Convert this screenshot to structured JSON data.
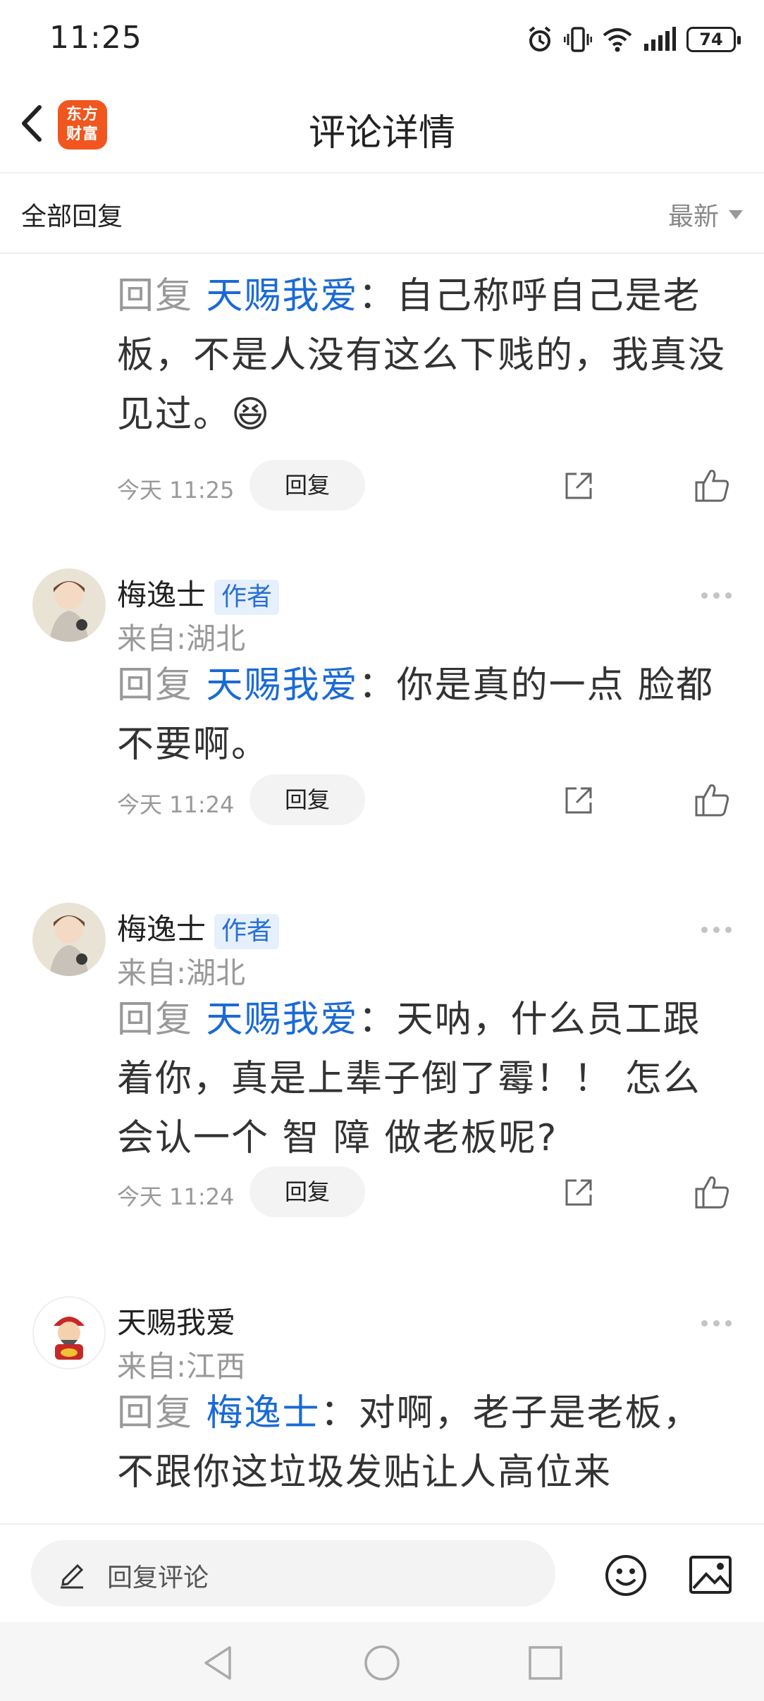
{
  "status_bar": {
    "time": "11:25",
    "battery": "74"
  },
  "nav": {
    "app_logo_line1": "东方",
    "app_logo_line2": "财富",
    "title": "评论详情"
  },
  "filter": {
    "label": "全部回复",
    "sort": "最新"
  },
  "comments": [
    {
      "text_prefix": "回复",
      "mention": "天赐我爱",
      "text_body": "：自己称呼自己是老板，不是人没有这么下贱的，我真没见过。",
      "emoji": "😆",
      "time": "今天 11:25",
      "reply_label": "回复"
    },
    {
      "username": "梅逸士",
      "badge": "作者",
      "location": "来自:湖北",
      "text_prefix": "回复",
      "mention": "天赐我爱",
      "text_body": "：你是真的一点 脸都不要啊。",
      "time": "今天 11:24",
      "reply_label": "回复"
    },
    {
      "username": "梅逸士",
      "badge": "作者",
      "location": "来自:湖北",
      "text_prefix": "回复",
      "mention": "天赐我爱",
      "text_body": "：天呐，什么员工跟着你，真是上辈子倒了霉！！ 怎么会认一个 智 障 做老板呢?",
      "time": "今天 11:24",
      "reply_label": "回复"
    },
    {
      "username": "天赐我爱",
      "location": "来自:江西",
      "text_prefix": "回复",
      "mention": "梅逸士",
      "text_body": "：对啊，老子是老板，不跟你这垃圾发贴让人高位来"
    }
  ],
  "bottom_bar": {
    "input_placeholder": "回复评论"
  }
}
